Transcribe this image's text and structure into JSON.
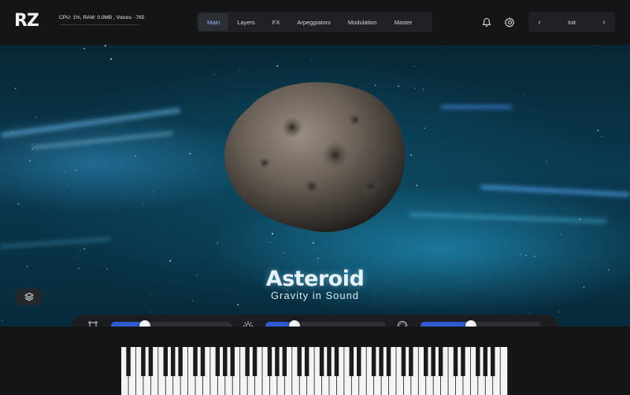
{
  "header": {
    "logo": "RZ",
    "stats": "CPU: 1%, RAM: 0.0MB , Voices: -765"
  },
  "nav": {
    "tabs": [
      {
        "label": "Main",
        "active": true
      },
      {
        "label": "Layers",
        "active": false
      },
      {
        "label": "FX",
        "active": false
      },
      {
        "label": "Arpeggiators",
        "active": false
      },
      {
        "label": "Modulation",
        "active": false
      },
      {
        "label": "Master",
        "active": false
      }
    ]
  },
  "icons": {
    "notifications": "bell-icon",
    "settings": "gear-icon",
    "prev": "chevron-left-icon",
    "next": "chevron-right-icon",
    "layers": "layers-icon"
  },
  "preset": {
    "name": "Init",
    "prev_glyph": "‹",
    "next_glyph": "›"
  },
  "hero": {
    "title": "Asteroid",
    "subtitle": "Gravity in Sound"
  },
  "controls": [
    {
      "name": "size",
      "icon": "frame-icon",
      "value": 0.28
    },
    {
      "name": "brightness",
      "icon": "sun-icon",
      "value": 0.24
    },
    {
      "name": "texture",
      "icon": "circle-icon",
      "value": 0.42
    }
  ],
  "colors": {
    "accent": "#2e5bd0",
    "active_tab_text": "#8fb8ff"
  }
}
